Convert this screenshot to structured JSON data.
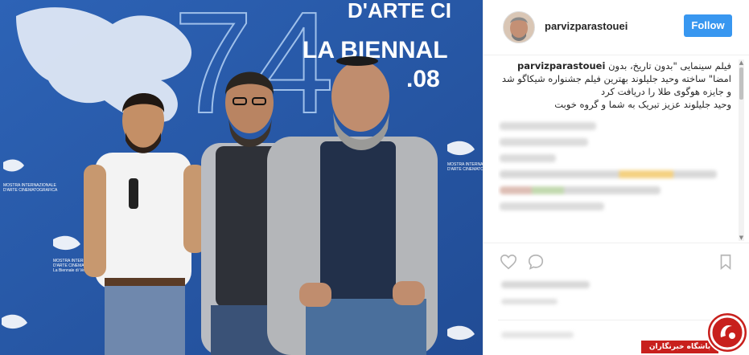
{
  "photo": {
    "backdrop_text": {
      "line1": "D'ARTE CI",
      "line2": "LA BIENNAL",
      "line3": ".08",
      "big_number": "74"
    },
    "logo_text": {
      "mostra": "MOSTRA INTERNAZIONALE",
      "arte": "D'ARTE CINEMATOGRAFICA",
      "biennale": "La Biennale di Venezia 2017"
    },
    "colors": {
      "backdrop": "#2c5aa8",
      "text": "#ffffff"
    }
  },
  "post": {
    "username": "parvizparastouei",
    "follow_label": "Follow",
    "caption_user": "parvizparastouei",
    "caption_lines": [
      "فیلم سینمایی \"بدون تاریخ، بدون",
      "امضا\" ساخته وحید جلیلوند بهترین فیلم جشنواره شیکاگو شد",
      "و جایزه هوگوی طلا را دریافت کرد",
      "وحید جلیلوند عزیز تبریک به شما و گروه خوبت"
    ],
    "icons": [
      "heart-icon",
      "comment-icon",
      "bookmark-icon"
    ],
    "accent_color": "#3897f0"
  },
  "watermark": {
    "label": "باشگاه خبرنگاران",
    "color": "#c8201d"
  }
}
